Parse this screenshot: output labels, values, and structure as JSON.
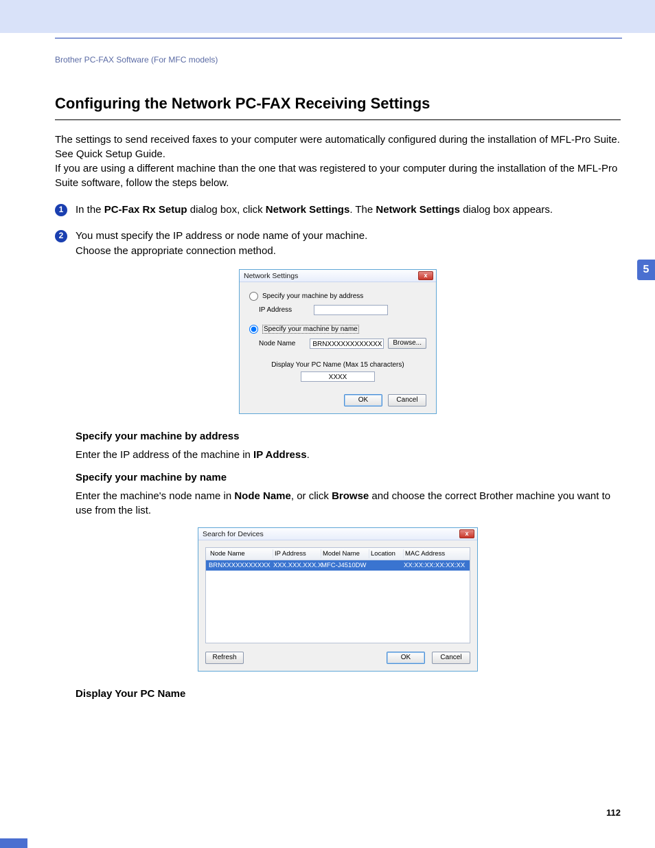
{
  "breadcrumb": "Brother PC-FAX Software (For MFC models)",
  "heading": "Configuring the Network PC-FAX Receiving Settings",
  "intro_p1": "The settings to send received faxes to your computer were automatically configured during the installation of MFL-Pro Suite. See Quick Setup Guide.",
  "intro_p2": "If you are using a different machine than the one that was registered to your computer during the installation of the MFL-Pro Suite software, follow the steps below.",
  "step1": {
    "num": "1",
    "pre": "In the ",
    "b1": "PC-Fax Rx Setup",
    "mid1": " dialog box, click ",
    "b2": "Network Settings",
    "mid2": ". The ",
    "b3": "Network Settings",
    "post": " dialog box appears."
  },
  "step2": {
    "num": "2",
    "line1": "You must specify the IP address or node name of your machine.",
    "line2": "Choose the appropriate connection method."
  },
  "dialog1": {
    "title": "Network Settings",
    "close": "x",
    "radio_addr": "Specify your machine by address",
    "ip_label": "IP Address",
    "ip_value": "",
    "radio_name": "Specify your machine by name",
    "node_label": "Node Name",
    "node_value": "BRNXXXXXXXXXXXX",
    "browse": "Browse...",
    "pcname_label": "Display Your PC Name (Max 15 characters)",
    "pcname_value": "XXXX",
    "ok": "OK",
    "cancel": "Cancel"
  },
  "sec_addr_h": "Specify your machine by address",
  "sec_addr_p_pre": "Enter the IP address of the machine in ",
  "sec_addr_p_b": "IP Address",
  "sec_addr_p_post": ".",
  "sec_name_h": "Specify your machine by name",
  "sec_name_p_pre": "Enter the machine's node name in ",
  "sec_name_p_b1": "Node Name",
  "sec_name_p_mid": ", or click ",
  "sec_name_p_b2": "Browse",
  "sec_name_p_post": " and choose the correct Brother machine you want to use from the list.",
  "dialog2": {
    "title": "Search for Devices",
    "close": "x",
    "cols": {
      "c1": "Node Name",
      "c2": "IP Address",
      "c3": "Model Name",
      "c4": "Location",
      "c5": "MAC Address"
    },
    "row": {
      "c1": "BRNXXXXXXXXXXX",
      "c2": "XXX.XXX.XXX.X",
      "c3": "MFC-J4510DW",
      "c4": "",
      "c5": "XX:XX:XX:XX:XX:XX"
    },
    "refresh": "Refresh",
    "ok": "OK",
    "cancel": "Cancel"
  },
  "sec_pcname_h": "Display Your PC Name",
  "chapter": "5",
  "page_number": "112"
}
